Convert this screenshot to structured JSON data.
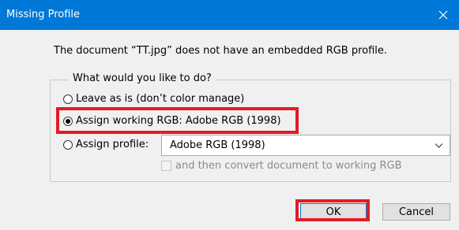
{
  "window": {
    "title": "Missing Profile",
    "close_icon": "close-icon"
  },
  "message": "The document “TT.jpg” does not have an embedded RGB profile.",
  "group": {
    "legend": "What would you like to do?",
    "options": {
      "leave": {
        "label": "Leave as is (don’t color manage)",
        "selected": false
      },
      "working": {
        "label": "Assign working RGB:  Adobe RGB (1998)",
        "selected": true
      },
      "profile": {
        "label": "Assign profile:",
        "selected": false
      }
    },
    "profile_select": {
      "value": "Adobe RGB (1998)",
      "icon": "chevron-down-icon"
    },
    "convert_checkbox": {
      "label": "and then convert document to working RGB",
      "checked": false,
      "disabled": true
    }
  },
  "buttons": {
    "ok": "OK",
    "cancel": "Cancel"
  },
  "colors": {
    "titlebar": "#0078d7",
    "highlight": "#e31b23",
    "dialog_bg": "#f0f0f0"
  }
}
